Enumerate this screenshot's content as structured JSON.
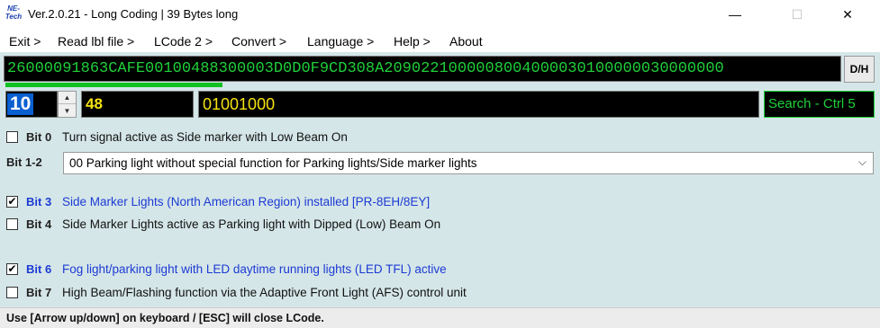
{
  "window": {
    "logo_text": "NE-Tech",
    "title": "Ver.2.0.21 - Long Coding | 39 Bytes long",
    "minimize": "—",
    "maximize": "☐",
    "close": "✕"
  },
  "menu": {
    "items": [
      "Exit >",
      "Read lbl file >",
      "LCode 2 >",
      "Convert >",
      "Language >",
      "Help >",
      "About"
    ]
  },
  "coding": {
    "value": "26000091863CAFE00100488300003D0D0F9CD308A2090221000008004000030100000030000000",
    "dh_label": "D/H",
    "progress": 0.25
  },
  "byte": {
    "index": "10",
    "hex": "48",
    "binary": "01001000",
    "search_label": "Search - Ctrl 5"
  },
  "bits": [
    {
      "label": "Bit 0",
      "desc": "Turn signal active as Side marker with Low Beam On",
      "checked": false
    },
    {
      "label": "Bit 3",
      "desc": "Side Marker Lights (North American Region) installed [PR-8EH/8EY]",
      "checked": true
    },
    {
      "label": "Bit 4",
      "desc": "Side Marker Lights active as Parking light with Dipped (Low) Beam On",
      "checked": false
    },
    {
      "label": "Bit 6",
      "desc": "Fog light/parking light with LED daytime running lights (LED TFL) active",
      "checked": true
    },
    {
      "label": "Bit 7",
      "desc": "High Beam/Flashing function via the Adaptive Front Light (AFS) control unit",
      "checked": false
    }
  ],
  "bit12": {
    "label": "Bit 1-2",
    "selected": "00 Parking light without special function for Parking lights/Side marker lights"
  },
  "status": {
    "text": "Use [Arrow up/down] on keyboard / [ESC] will close LCode."
  },
  "colors": {
    "accent_active": "#1c3bd4",
    "code_green": "#1fd13a",
    "hex_yellow": "#f5e310",
    "panel_bg": "#d5e6e8"
  }
}
